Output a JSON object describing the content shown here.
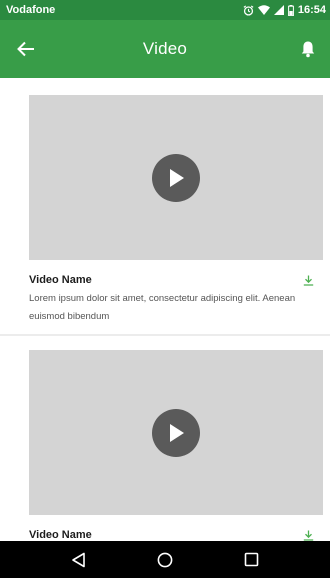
{
  "status_bar": {
    "carrier": "Vodafone",
    "time": "16:54",
    "icons": [
      "alarm-icon",
      "wifi-icon",
      "signal-icon",
      "battery-icon"
    ]
  },
  "app_bar": {
    "title": "Video",
    "back_icon": "arrow-left-icon",
    "bell_icon": "bell-icon"
  },
  "videos": [
    {
      "name": "Video Name",
      "description": "Lorem ipsum dolor sit amet, consectetur adipiscing elit. Aenean euismod bibendum"
    },
    {
      "name": "Video Name",
      "description": ""
    }
  ],
  "nav_bar": {
    "icons": [
      "back-triangle-icon",
      "home-circle-icon",
      "recents-square-icon"
    ]
  },
  "colors": {
    "status_bar": "#2b8a40",
    "app_bar": "#389d48",
    "thumbnail": "#d4d4d4",
    "play_button": "#5a5a5a",
    "download_accent": "#4caf50",
    "nav_bar": "#000000"
  }
}
